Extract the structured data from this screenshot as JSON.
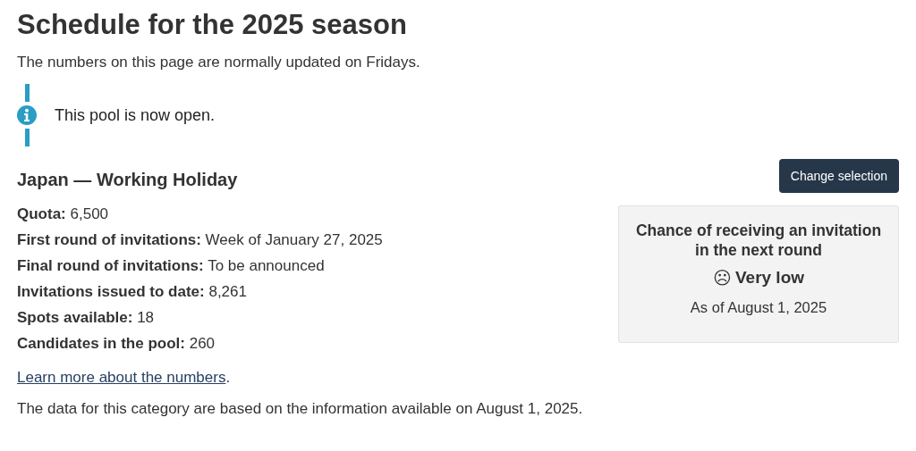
{
  "title": "Schedule for the 2025 season",
  "subtitle": "The numbers on this page are normally updated on Fridays.",
  "alert": {
    "kind": "info",
    "text": "This pool is now open."
  },
  "category": {
    "heading": "Japan — Working Holiday",
    "facts": [
      {
        "label": "Quota:",
        "value": "6,500"
      },
      {
        "label": "First round of invitations:",
        "value": "Week of January 27, 2025"
      },
      {
        "label": "Final round of invitations:",
        "value": "To be announced"
      },
      {
        "label": "Invitations issued to date:",
        "value": "8,261"
      },
      {
        "label": "Spots available:",
        "value": "18"
      },
      {
        "label": "Candidates in the pool:",
        "value": "260"
      }
    ],
    "link": {
      "text": "Learn more about the numbers",
      "after": "."
    },
    "note": "The data for this category are based on the information available on August 1, 2025."
  },
  "change_button": "Change selection",
  "chance_card": {
    "title": "Chance of receiving an invitation in the next round",
    "symbol": "☹",
    "rating": "Very low",
    "as_of": "As of August 1, 2025"
  }
}
